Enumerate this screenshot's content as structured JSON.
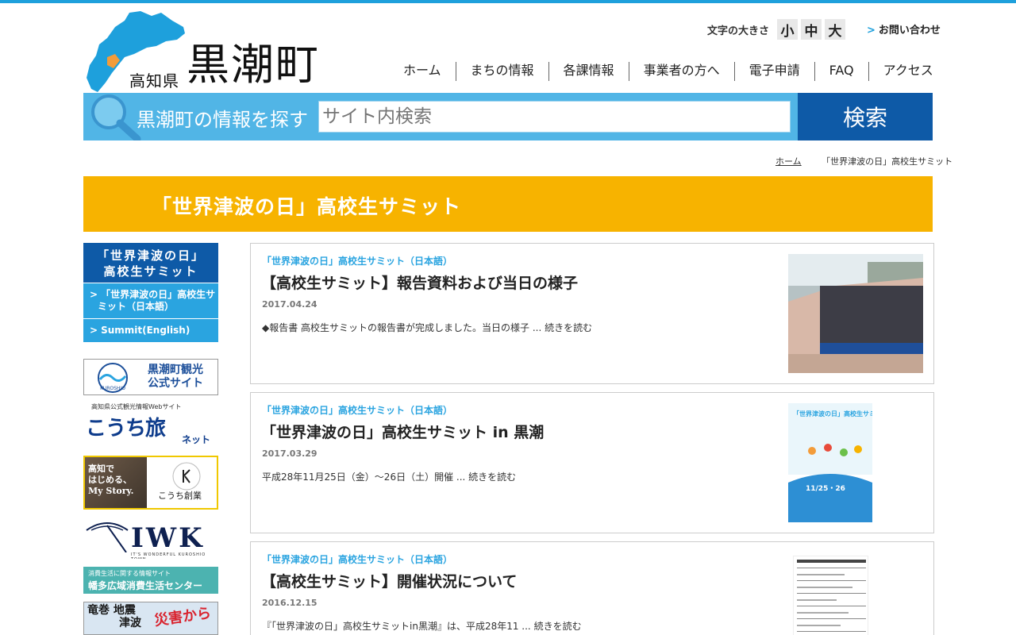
{
  "header": {
    "prefecture": "高知県",
    "town": "黒潮町",
    "fontsize_label": "文字の大きさ",
    "fontsize_options": [
      "小",
      "中",
      "大"
    ],
    "contact_label": "お問い合わせ"
  },
  "nav": [
    "ホーム",
    "まちの情報",
    "各課情報",
    "事業者の方へ",
    "電子申請",
    "FAQ",
    "アクセス"
  ],
  "search": {
    "label": "黒潮町の情報を探す",
    "placeholder": "サイト内検索",
    "button": "検索"
  },
  "breadcrumb": {
    "home": "ホーム",
    "current": "「世界津波の日」高校生サミット"
  },
  "page_title": "「世界津波の日」高校生サミット",
  "sidebar": {
    "heading_line1": "「世界津波の日」",
    "heading_line2": "高校生サミット",
    "items": [
      {
        "label_line1": "「世界津波の日」高校生サ",
        "label_line2": "ミット（日本語）"
      },
      {
        "label_line1": "Summit(English)"
      }
    ]
  },
  "banners": {
    "kuroshio": {
      "line1": "黒潮町観光",
      "line2": "公式サイト",
      "logo": "KUROSHIO"
    },
    "kochi_tabi": {
      "small": "高知県公式観光情報Webサイト",
      "big": "こうち旅",
      "net": "ネット"
    },
    "kochi_sogyo": {
      "photo_text_1": "高知で",
      "photo_text_2": "はじめる、",
      "photo_text_3": "My Story.",
      "right_text": "こうち創業"
    },
    "iwk": {
      "big": "IWK",
      "caption": "IT'S WONDERFUL KUROSHIO TOWN"
    },
    "consumer": {
      "line1": "消費生活に関する情報サイト",
      "line2": "幡多広域消費生活センター"
    },
    "disaster": {
      "line1": "竜巻 地震",
      "line2": "津波",
      "right": "災害から"
    }
  },
  "articles": [
    {
      "category": "「世界津波の日」高校生サミット（日本語）",
      "title": "【高校生サミット】報告資料および当日の様子",
      "date": "2017.04.24",
      "excerpt": "◆報告書 高校生サミットの報告書が完成しました。当日の様子 ... ",
      "more": "続きを読む"
    },
    {
      "category": "「世界津波の日」高校生サミット（日本語）",
      "title": "「世界津波の日」高校生サミット in 黒潮",
      "date": "2017.03.29",
      "excerpt": "平成28年11月25日（金）～26日（土）開催 ... ",
      "more": "続きを読む",
      "poster_title": "「世界津波の日」高校生サミット in黒潮",
      "poster_dates": "11/25・26"
    },
    {
      "category": "「世界津波の日」高校生サミット（日本語）",
      "title": "【高校生サミット】開催状況について",
      "date": "2016.12.15",
      "excerpt": "『「世界津波の日」高校生サミットin黒潮』は、平成28年11 ... ",
      "more": "続きを読む"
    }
  ],
  "colors": {
    "accent_blue": "#1ea0dc",
    "navy": "#0e5aa7",
    "title_yellow": "#f7b300",
    "search_blue": "#51b5e6"
  }
}
